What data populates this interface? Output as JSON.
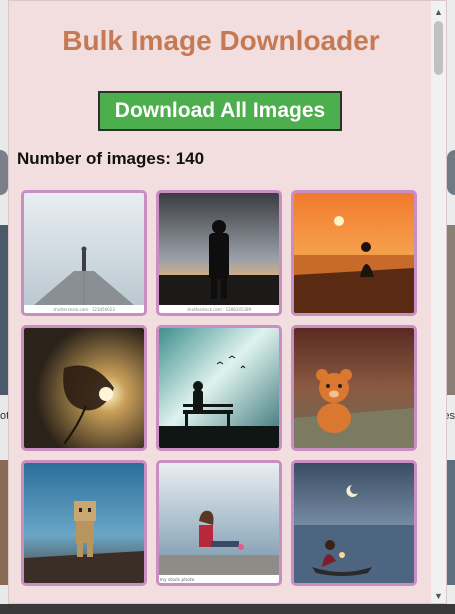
{
  "popup": {
    "title": "Bulk Image Downloader",
    "download_label": "Download All Images",
    "count_label": "Number of images: 140"
  },
  "thumbnails": [
    {
      "name": "pier-fog-person",
      "watermark": "shutterstock.com · 123456023"
    },
    {
      "name": "silhouette-sunset",
      "watermark": "shutterstock.com · 1288345389"
    },
    {
      "name": "girl-sea-sunset"
    },
    {
      "name": "leaf-sun"
    },
    {
      "name": "bench-silhouette"
    },
    {
      "name": "teddy-bear"
    },
    {
      "name": "cardboard-robot"
    },
    {
      "name": "girl-sitting-sea",
      "watermark": "my stock photo"
    },
    {
      "name": "girl-boat-moon"
    }
  ],
  "background_page": {
    "left_text": "ot",
    "right_text": "es"
  },
  "colors": {
    "popup_bg": "#f2dede",
    "title": "#c47a54",
    "button": "#4cae4c",
    "thumb_border": "#c98fc4"
  }
}
